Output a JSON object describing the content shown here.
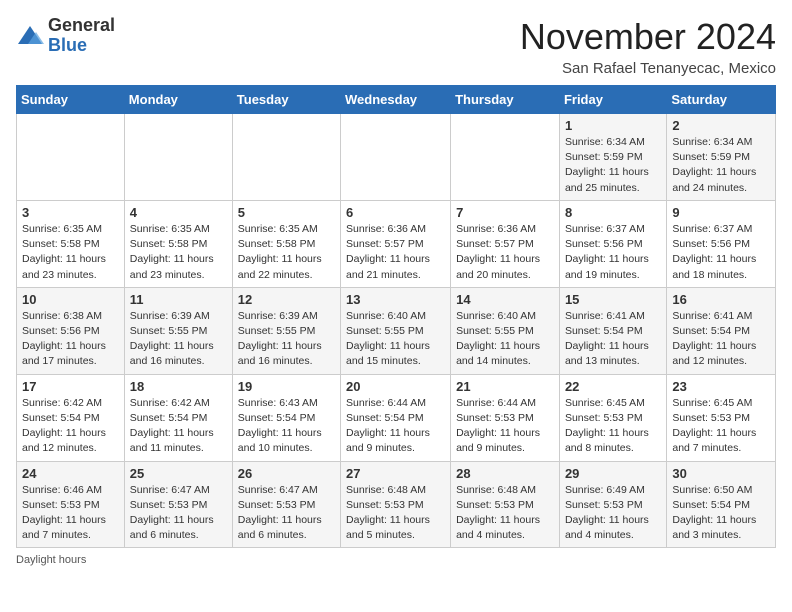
{
  "logo": {
    "general": "General",
    "blue": "Blue"
  },
  "header": {
    "month_title": "November 2024",
    "location": "San Rafael Tenanyecac, Mexico"
  },
  "days_of_week": [
    "Sunday",
    "Monday",
    "Tuesday",
    "Wednesday",
    "Thursday",
    "Friday",
    "Saturday"
  ],
  "weeks": [
    [
      {
        "day": "",
        "info": ""
      },
      {
        "day": "",
        "info": ""
      },
      {
        "day": "",
        "info": ""
      },
      {
        "day": "",
        "info": ""
      },
      {
        "day": "",
        "info": ""
      },
      {
        "day": "1",
        "info": "Sunrise: 6:34 AM\nSunset: 5:59 PM\nDaylight: 11 hours and 25 minutes."
      },
      {
        "day": "2",
        "info": "Sunrise: 6:34 AM\nSunset: 5:59 PM\nDaylight: 11 hours and 24 minutes."
      }
    ],
    [
      {
        "day": "3",
        "info": "Sunrise: 6:35 AM\nSunset: 5:58 PM\nDaylight: 11 hours and 23 minutes."
      },
      {
        "day": "4",
        "info": "Sunrise: 6:35 AM\nSunset: 5:58 PM\nDaylight: 11 hours and 23 minutes."
      },
      {
        "day": "5",
        "info": "Sunrise: 6:35 AM\nSunset: 5:58 PM\nDaylight: 11 hours and 22 minutes."
      },
      {
        "day": "6",
        "info": "Sunrise: 6:36 AM\nSunset: 5:57 PM\nDaylight: 11 hours and 21 minutes."
      },
      {
        "day": "7",
        "info": "Sunrise: 6:36 AM\nSunset: 5:57 PM\nDaylight: 11 hours and 20 minutes."
      },
      {
        "day": "8",
        "info": "Sunrise: 6:37 AM\nSunset: 5:56 PM\nDaylight: 11 hours and 19 minutes."
      },
      {
        "day": "9",
        "info": "Sunrise: 6:37 AM\nSunset: 5:56 PM\nDaylight: 11 hours and 18 minutes."
      }
    ],
    [
      {
        "day": "10",
        "info": "Sunrise: 6:38 AM\nSunset: 5:56 PM\nDaylight: 11 hours and 17 minutes."
      },
      {
        "day": "11",
        "info": "Sunrise: 6:39 AM\nSunset: 5:55 PM\nDaylight: 11 hours and 16 minutes."
      },
      {
        "day": "12",
        "info": "Sunrise: 6:39 AM\nSunset: 5:55 PM\nDaylight: 11 hours and 16 minutes."
      },
      {
        "day": "13",
        "info": "Sunrise: 6:40 AM\nSunset: 5:55 PM\nDaylight: 11 hours and 15 minutes."
      },
      {
        "day": "14",
        "info": "Sunrise: 6:40 AM\nSunset: 5:55 PM\nDaylight: 11 hours and 14 minutes."
      },
      {
        "day": "15",
        "info": "Sunrise: 6:41 AM\nSunset: 5:54 PM\nDaylight: 11 hours and 13 minutes."
      },
      {
        "day": "16",
        "info": "Sunrise: 6:41 AM\nSunset: 5:54 PM\nDaylight: 11 hours and 12 minutes."
      }
    ],
    [
      {
        "day": "17",
        "info": "Sunrise: 6:42 AM\nSunset: 5:54 PM\nDaylight: 11 hours and 12 minutes."
      },
      {
        "day": "18",
        "info": "Sunrise: 6:42 AM\nSunset: 5:54 PM\nDaylight: 11 hours and 11 minutes."
      },
      {
        "day": "19",
        "info": "Sunrise: 6:43 AM\nSunset: 5:54 PM\nDaylight: 11 hours and 10 minutes."
      },
      {
        "day": "20",
        "info": "Sunrise: 6:44 AM\nSunset: 5:54 PM\nDaylight: 11 hours and 9 minutes."
      },
      {
        "day": "21",
        "info": "Sunrise: 6:44 AM\nSunset: 5:53 PM\nDaylight: 11 hours and 9 minutes."
      },
      {
        "day": "22",
        "info": "Sunrise: 6:45 AM\nSunset: 5:53 PM\nDaylight: 11 hours and 8 minutes."
      },
      {
        "day": "23",
        "info": "Sunrise: 6:45 AM\nSunset: 5:53 PM\nDaylight: 11 hours and 7 minutes."
      }
    ],
    [
      {
        "day": "24",
        "info": "Sunrise: 6:46 AM\nSunset: 5:53 PM\nDaylight: 11 hours and 7 minutes."
      },
      {
        "day": "25",
        "info": "Sunrise: 6:47 AM\nSunset: 5:53 PM\nDaylight: 11 hours and 6 minutes."
      },
      {
        "day": "26",
        "info": "Sunrise: 6:47 AM\nSunset: 5:53 PM\nDaylight: 11 hours and 6 minutes."
      },
      {
        "day": "27",
        "info": "Sunrise: 6:48 AM\nSunset: 5:53 PM\nDaylight: 11 hours and 5 minutes."
      },
      {
        "day": "28",
        "info": "Sunrise: 6:48 AM\nSunset: 5:53 PM\nDaylight: 11 hours and 4 minutes."
      },
      {
        "day": "29",
        "info": "Sunrise: 6:49 AM\nSunset: 5:53 PM\nDaylight: 11 hours and 4 minutes."
      },
      {
        "day": "30",
        "info": "Sunrise: 6:50 AM\nSunset: 5:54 PM\nDaylight: 11 hours and 3 minutes."
      }
    ]
  ],
  "footer": {
    "note": "Daylight hours"
  }
}
